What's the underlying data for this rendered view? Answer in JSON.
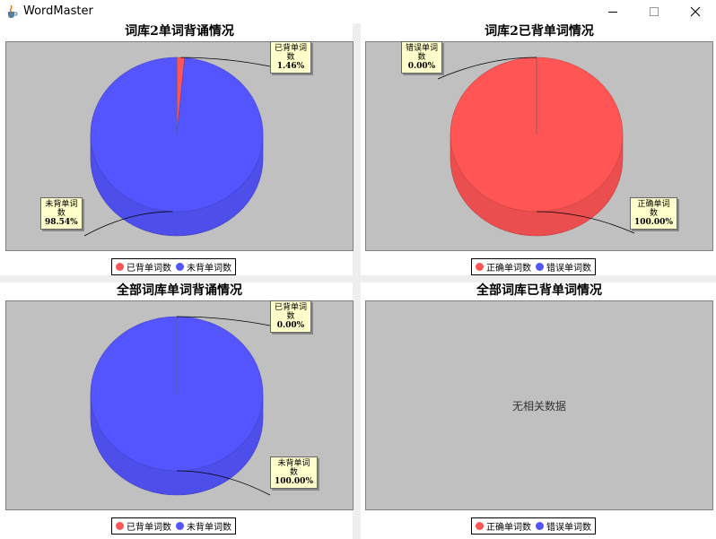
{
  "window": {
    "title": "WordMaster"
  },
  "colors": {
    "slice_a": "#ff5555",
    "slice_b": "#5555ff",
    "plot_bg": "#c0c0c0"
  },
  "charts": [
    {
      "title": "词库2单词背诵情况",
      "slices": [
        {
          "name": "已背单词数",
          "text": "已背单词数",
          "pct": "1.46%",
          "value": 1.46
        },
        {
          "name": "未背单词数",
          "text": "未背单词数",
          "pct": "98.54%",
          "value": 98.54
        }
      ],
      "legend": [
        {
          "label": "已背单词数"
        },
        {
          "label": "未背单词数"
        }
      ]
    },
    {
      "title": "词库2已背单词情况",
      "slices": [
        {
          "name": "正确单词数",
          "text": "正确单词数",
          "pct": "100.00%",
          "value": 100.0
        },
        {
          "name": "错误单词数",
          "text": "错误单词数",
          "pct": "0.00%",
          "value": 0.0
        }
      ],
      "legend": [
        {
          "label": "正确单词数"
        },
        {
          "label": "错误单词数"
        }
      ]
    },
    {
      "title": "全部词库单词背诵情况",
      "slices": [
        {
          "name": "已背单词数",
          "text": "已背单词数",
          "pct": "0.00%",
          "value": 0.0
        },
        {
          "name": "未背单词数",
          "text": "未背单词数",
          "pct": "100.00%",
          "value": 100.0
        }
      ],
      "legend": [
        {
          "label": "已背单词数"
        },
        {
          "label": "未背单词数"
        }
      ]
    },
    {
      "title": "全部词库已背单词情况",
      "no_data": "无相关数据",
      "legend": [
        {
          "label": "正确单词数"
        },
        {
          "label": "错误单词数"
        }
      ]
    }
  ],
  "chart_data": [
    {
      "type": "pie",
      "title": "词库2单词背诵情况",
      "labels": [
        "已背单词数",
        "未背单词数"
      ],
      "values": [
        1.46,
        98.54
      ],
      "unit": "%",
      "colors": [
        "#ff5555",
        "#5555ff"
      ],
      "legend_position": "bottom"
    },
    {
      "type": "pie",
      "title": "词库2已背单词情况",
      "labels": [
        "正确单词数",
        "错误单词数"
      ],
      "values": [
        100.0,
        0.0
      ],
      "unit": "%",
      "colors": [
        "#ff5555",
        "#5555ff"
      ],
      "legend_position": "bottom"
    },
    {
      "type": "pie",
      "title": "全部词库单词背诵情况",
      "labels": [
        "已背单词数",
        "未背单词数"
      ],
      "values": [
        0.0,
        100.0
      ],
      "unit": "%",
      "colors": [
        "#ff5555",
        "#5555ff"
      ],
      "legend_position": "bottom"
    },
    {
      "type": "pie",
      "title": "全部词库已背单词情况",
      "labels": [
        "正确单词数",
        "错误单词数"
      ],
      "values": [],
      "unit": "%",
      "colors": [
        "#ff5555",
        "#5555ff"
      ],
      "legend_position": "bottom"
    }
  ]
}
